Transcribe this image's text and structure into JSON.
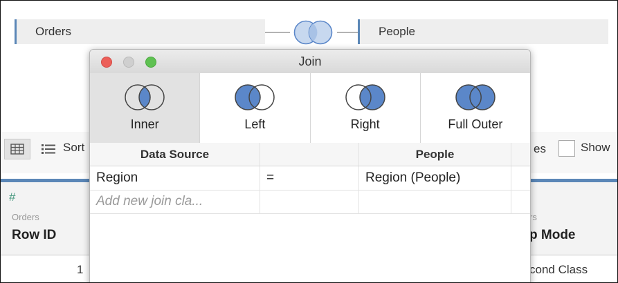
{
  "canvas": {
    "left_table": "Orders",
    "right_table": "People"
  },
  "background": {
    "sort_label": "Sort",
    "ies_label": "es",
    "show_label": "Show",
    "col1_source": "Orders",
    "col1_name": "Row ID",
    "col2_source": "rs",
    "col2_name": "p Mode",
    "row1_id": "1",
    "row1_ship_mode": "cond Class"
  },
  "dialog": {
    "title": "Join",
    "join_types": [
      {
        "label": "Inner",
        "selected": true
      },
      {
        "label": "Left",
        "selected": false
      },
      {
        "label": "Right",
        "selected": false
      },
      {
        "label": "Full Outer",
        "selected": false
      }
    ],
    "clause_headers": [
      "Data Source",
      "",
      "People",
      ""
    ],
    "clauses": [
      {
        "left": "Region",
        "op": "=",
        "right": "Region (People)"
      }
    ],
    "add_clause_placeholder": "Add new join cla..."
  },
  "colors": {
    "accent_blue": "#5b87b7",
    "venn_fill": "#5b87c9",
    "venn_light": "#c7d8ef",
    "close": "#ec5f59",
    "maximize": "#5fc152"
  }
}
